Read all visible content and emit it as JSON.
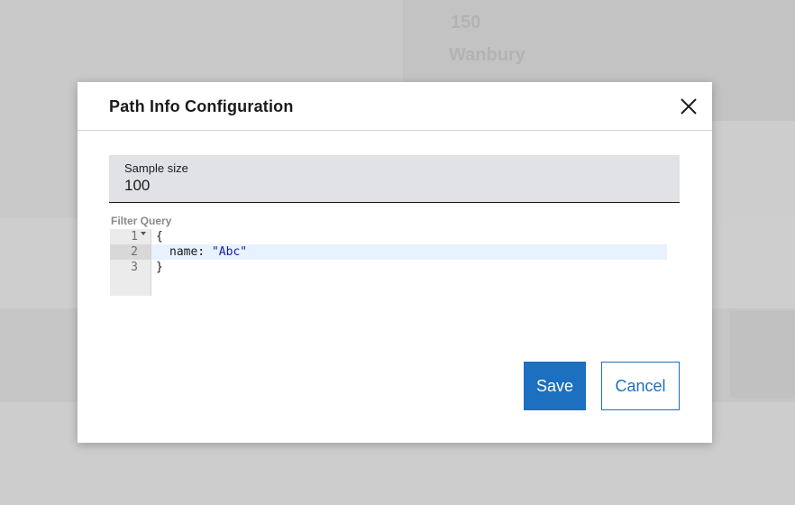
{
  "dialog": {
    "title": "Path Info Configuration",
    "close_icon": "close-icon",
    "sample_size": {
      "label": "Sample size",
      "value": "100"
    },
    "filter_query": {
      "label": "Filter Query",
      "lines": [
        {
          "number": "1",
          "text": "{"
        },
        {
          "number": "2",
          "key": "name:",
          "value": "\"Abc\""
        },
        {
          "number": "3",
          "text": "}"
        }
      ]
    },
    "save_label": "Save",
    "cancel_label": "Cancel"
  },
  "background": {
    "text_1": "150",
    "text_2": "Wanbury"
  },
  "colors": {
    "primary": "#1d6fbf",
    "field_bg": "#e0e2e5",
    "active_line": "#e8f2fe",
    "string": "#1a1aa6"
  }
}
